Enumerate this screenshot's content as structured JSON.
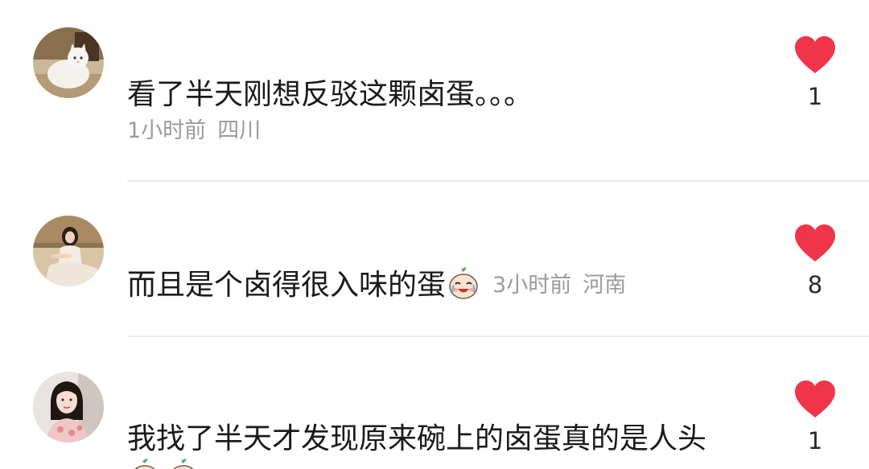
{
  "comments": [
    {
      "text": "看了半天刚想反驳这颗卤蛋。。。",
      "time": "1小时前",
      "location": "四川",
      "likes": "1",
      "avatar_icon": "avatar-white-cat-photo"
    },
    {
      "text": "而且是个卤得很入味的蛋",
      "emoji_icon": "crying-laughing-egg-emoji",
      "time": "3小时前",
      "location": "河南",
      "likes": "8",
      "avatar_icon": "avatar-woman-sitting-photo"
    },
    {
      "text": "我找了半天才发现原来碗上的卤蛋真的是人头",
      "emoji_icon": "crying-laughing-egg-emoji",
      "likes": "1",
      "avatar_icon": "avatar-woman-portrait-photo"
    }
  ],
  "colors": {
    "like_heart": "#f0354a",
    "meta_text": "#9b9b9b",
    "main_text": "#1a1a1a",
    "divider": "#ececec"
  }
}
